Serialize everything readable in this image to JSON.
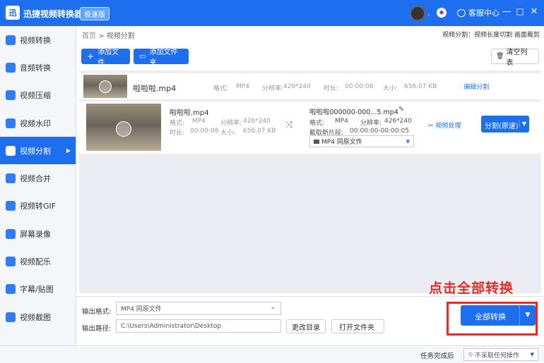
{
  "app": {
    "title": "迅捷视频转换器",
    "badge": "极速版",
    "logo_glyph": "迅",
    "service_label": "客服中心",
    "dot": ".",
    "vip_glyph": "◆"
  },
  "window": {
    "minimize": "—",
    "maximize": "□",
    "close": "✕"
  },
  "sidebar": {
    "items": [
      {
        "label": "视频转换"
      },
      {
        "label": "音频转换"
      },
      {
        "label": "视频压缩"
      },
      {
        "label": "视频水印"
      },
      {
        "label": "视频分割",
        "active": true,
        "arrow": "▶"
      },
      {
        "label": "视频合并"
      },
      {
        "label": "视频转GIF"
      },
      {
        "label": "屏幕录像"
      },
      {
        "label": "视频配乐"
      },
      {
        "label": "字幕/贴图"
      },
      {
        "label": "视频截图"
      }
    ]
  },
  "breadcrumb": {
    "home": "首页",
    "sep": ">",
    "current": "视频分割"
  },
  "hint": "视频分割：视频长度切割 画面裁剪",
  "toolbar": {
    "add_file": "添加文件",
    "add_file_icon": "+",
    "add_folder": "添加文件夹",
    "add_folder_icon": "▭",
    "clear": "清空列表",
    "clear_icon": "🗑"
  },
  "file_row": {
    "name": "啦啦啦.mp4",
    "format_label": "格式:",
    "format": "MP4",
    "res_label": "分辨率:",
    "res": "426*240",
    "dur_label": "时长:",
    "dur": "00:00:08",
    "size_label": "大小:",
    "size": "656.07 KB",
    "action": "编辑分割",
    "action_icon": "⫶"
  },
  "segment": {
    "name": "啦啦啦.mp4",
    "format_label": "格式:",
    "format": "MP4",
    "res_label": "分辨率:",
    "res": "426*240",
    "dur_label": "时长:",
    "dur": "00:00:08",
    "size_label": "大小:",
    "size": "656.07 KB",
    "shuffle_icon": "⤨",
    "out_name": "啦啦啦000000-000...5.mp4",
    "edit_icon": "✎",
    "out_format_label": "格式:",
    "out_format": "MP4",
    "out_res_label": "分辨率:",
    "out_res": "426*240",
    "clip_label": "截取新片段:",
    "clip": "00:00:00-00:00:05",
    "format_select": "MP4 同原文件",
    "process": "视频处理",
    "process_icon": "✂",
    "split_button": "分割(原速)",
    "caret": "▼"
  },
  "bottom": {
    "format_label": "输出格式:",
    "format_value": "MP4 同原文件",
    "path_label": "输出路径:",
    "path_value": "C:\\Users\\Administrator\\Desktop",
    "change_dir": "更改目录",
    "open_folder": "打开文件夹",
    "convert_all": "全部转换",
    "caret": "▼"
  },
  "annotation": "点击全部转换",
  "status": {
    "label": "任务完成后",
    "select": "不采取任何操作",
    "icon": "⦸",
    "caret": "▼"
  },
  "colors": {
    "primary": "#1e6ff0",
    "annotation": "#e42b2b"
  }
}
